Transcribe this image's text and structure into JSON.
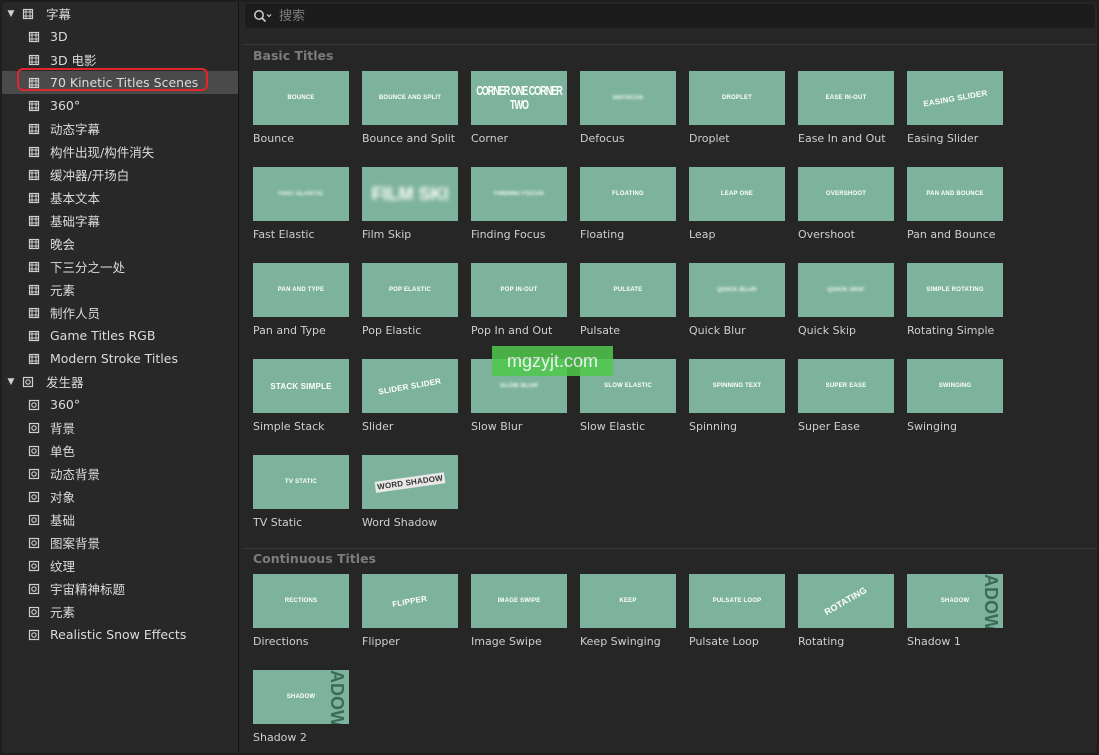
{
  "sidebar": {
    "groups": [
      {
        "label": "字幕",
        "children": [
          "3D",
          "3D 电影",
          "70 Kinetic Titles Scenes",
          "360°",
          "动态字幕",
          "构件出现/构件消失",
          "缓冲器/开场白",
          "基本文本",
          "基础字幕",
          "晚会",
          "下三分之一处",
          "元素",
          "制作人员",
          "Game Titles RGB",
          "Modern Stroke Titles"
        ],
        "selected_index": 2
      },
      {
        "label": "发生器",
        "children": [
          "360°",
          "背景",
          "单色",
          "动态背景",
          "对象",
          "基础",
          "图案背景",
          "纹理",
          "宇宙精神标题",
          "元素",
          "Realistic Snow Effects"
        ]
      }
    ]
  },
  "search": {
    "placeholder": "搜索"
  },
  "sections": [
    {
      "title": "Basic Titles",
      "items": [
        {
          "name": "Bounce",
          "thumb": "BOUNCE"
        },
        {
          "name": "Bounce and Split",
          "thumb": "BOUNCE AND SPLIT"
        },
        {
          "name": "Corner",
          "thumb": "CORNER ONE CORNER TWO"
        },
        {
          "name": "Defocus",
          "thumb": "DEFOCUS"
        },
        {
          "name": "Droplet",
          "thumb": "DROPLET"
        },
        {
          "name": "Ease In and Out",
          "thumb": "EASE IN-OUT"
        },
        {
          "name": "Easing Slider",
          "thumb": "EASING SLIDER"
        },
        {
          "name": "Fast Elastic",
          "thumb": "FAST ELASTIC"
        },
        {
          "name": "Film Skip",
          "thumb": "FILM SKI"
        },
        {
          "name": "Finding Focus",
          "thumb": "FINDING FOCUS"
        },
        {
          "name": "Floating",
          "thumb": "FLOATING"
        },
        {
          "name": "Leap",
          "thumb": "LEAP ONE"
        },
        {
          "name": "Overshoot",
          "thumb": "OVERSHOOT"
        },
        {
          "name": "Pan and Bounce",
          "thumb": "PAN AND BOUNCE"
        },
        {
          "name": "Pan and Type",
          "thumb": "PAN AND TYPE"
        },
        {
          "name": "Pop Elastic",
          "thumb": "POP ELASTIC"
        },
        {
          "name": "Pop In and Out",
          "thumb": "POP IN-OUT"
        },
        {
          "name": "Pulsate",
          "thumb": "PULSATE"
        },
        {
          "name": "Quick Blur",
          "thumb": "QUICK BLUR"
        },
        {
          "name": "Quick Skip",
          "thumb": "QUICK SKIP"
        },
        {
          "name": "Rotating Simple",
          "thumb": "SIMPLE ROTATING"
        },
        {
          "name": "Simple Stack",
          "thumb": "STACK SIMPLE"
        },
        {
          "name": "Slider",
          "thumb": "SLIDER SLIDER"
        },
        {
          "name": "Slow Blur",
          "thumb": "SLOW BLUR"
        },
        {
          "name": "Slow Elastic",
          "thumb": "SLOW ELASTIC"
        },
        {
          "name": "Spinning",
          "thumb": "SPINNING TEXT"
        },
        {
          "name": "Super Ease",
          "thumb": "SUPER EASE"
        },
        {
          "name": "Swinging",
          "thumb": "SWINGING"
        },
        {
          "name": "TV Static",
          "thumb": "TV STATIC"
        },
        {
          "name": "Word Shadow",
          "thumb": "WORD SHADOW"
        }
      ]
    },
    {
      "title": "Continuous Titles",
      "items": [
        {
          "name": "Directions",
          "thumb": "RECTIONS"
        },
        {
          "name": "Flipper",
          "thumb": "FLIPPER"
        },
        {
          "name": "Image Swipe",
          "thumb": "IMAGE SWIPE"
        },
        {
          "name": "Keep Swinging",
          "thumb": "KEEP"
        },
        {
          "name": "Pulsate Loop",
          "thumb": "PULSATE LOOP"
        },
        {
          "name": "Rotating",
          "thumb": "ROTATING"
        },
        {
          "name": "Shadow 1",
          "thumb": "SHADOW",
          "side": "ADOW"
        },
        {
          "name": "Shadow 2",
          "thumb": "SHADOW",
          "side": "ADOW"
        }
      ]
    }
  ],
  "watermark": "mgzyjt.com",
  "colors": {
    "thumb_bg": "#7db39c",
    "selection": "#4a4a4a",
    "ring": "#e0262c"
  }
}
